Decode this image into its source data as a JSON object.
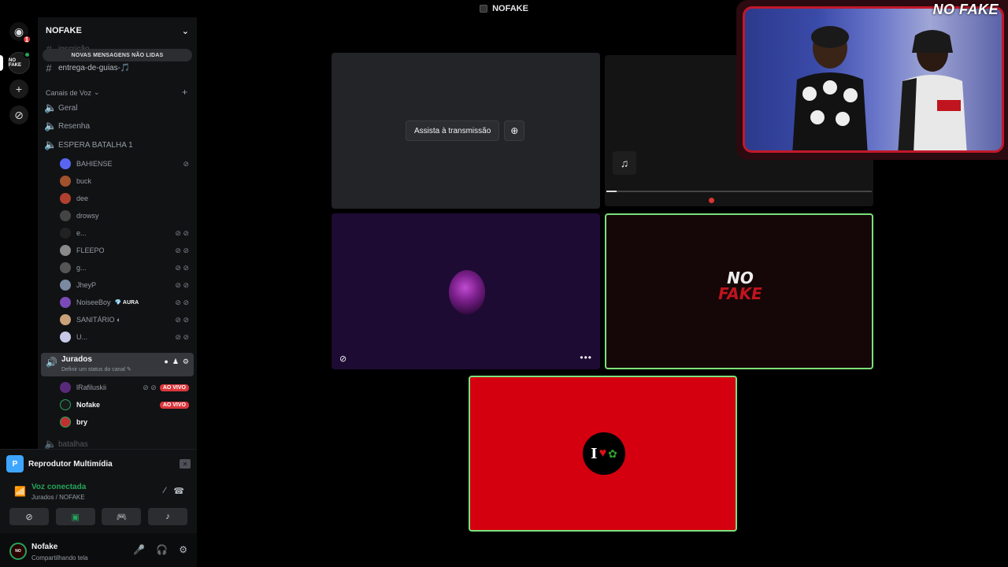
{
  "window": {
    "title": "NOFAKE"
  },
  "rail": {
    "badge": "1",
    "server_abbr": "NO FAKE"
  },
  "server": {
    "name": "NOFAKE"
  },
  "new_messages": "NOVAS MENSAGENS NÃO LIDAS",
  "text_channels": [
    {
      "name": "inscrição"
    },
    {
      "name": "entrega-de-guias-🎵"
    }
  ],
  "voice_category": "Canais de Voz",
  "voice_channels": [
    {
      "name": "Geral"
    },
    {
      "name": "Resenha"
    },
    {
      "name": "ESPERA BATALHA 1"
    }
  ],
  "espera_users": [
    {
      "name": "BAHIENSE",
      "color": "#5865f2"
    },
    {
      "name": "buck",
      "color": "#a0522d"
    },
    {
      "name": "dee",
      "color": "#b04030"
    },
    {
      "name": "drowsy",
      "color": "#444444"
    },
    {
      "name": "e...",
      "color": "#222222"
    },
    {
      "name": "FLEEPO",
      "color": "#8a8a8a"
    },
    {
      "name": "g...",
      "color": "#555555"
    },
    {
      "name": "JheyP",
      "color": "#7a8aa0"
    },
    {
      "name": "NoiseeBoy",
      "color": "#7a4ab8",
      "tag": "💎 AURA"
    },
    {
      "name": "SANITÁRIO ◐",
      "color": "#c9a27a"
    },
    {
      "name": "U...",
      "color": "#c8c8e8"
    }
  ],
  "jurados": {
    "name": "Jurados",
    "status": "Definir um status do canal ✎",
    "users": [
      {
        "name": "lRafiluskii",
        "color": "#5a2a7a",
        "live": "AO VIVO"
      },
      {
        "name": "Nofake",
        "color": "#1a1a1a",
        "live": "AO VIVO"
      },
      {
        "name": "bry",
        "color": "#c03030"
      }
    ]
  },
  "next_channel": "batalhas",
  "media_player": {
    "label": "Reprodutor Multimídia",
    "icon": "P"
  },
  "voice": {
    "status": "Voz conectada",
    "location": "Jurados / NOFAKE"
  },
  "user": {
    "name": "Nofake",
    "status": "Compartilhando tela"
  },
  "stage": {
    "watch_label": "Assista à transmissão",
    "logo_no": "NO",
    "logo_fake": "FAKE",
    "i_love": "I"
  },
  "cam": {
    "brand": "NO FAKE"
  },
  "colors": {
    "accent": "#23a55a",
    "live": "#da373c",
    "tile_border": "#7be07b"
  }
}
